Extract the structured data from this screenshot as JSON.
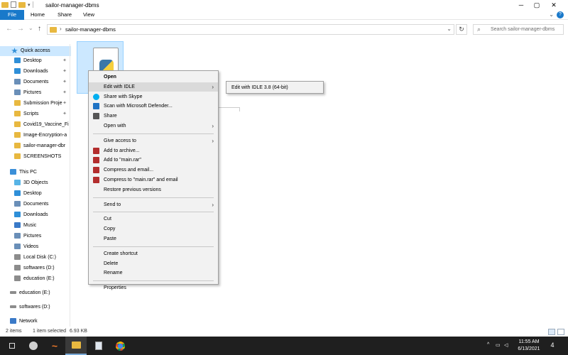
{
  "window": {
    "title": "sailor-manager-dbms",
    "controls": {
      "minimize": "─",
      "maximize": "▢",
      "close": "✕"
    }
  },
  "ribbon": {
    "tabs": [
      "File",
      "Home",
      "Share",
      "View"
    ],
    "help": "?"
  },
  "address": {
    "path": "sailor-manager-dbms",
    "separator": "›",
    "dropdown": "⌄",
    "refresh": "↻"
  },
  "search": {
    "placeholder": "Search sailor-manager-dbms",
    "icon": "⌕"
  },
  "nav": {
    "back": "←",
    "forward": "→",
    "recent": "⌄",
    "up": "↑",
    "quick_access": "Quick access",
    "pinned": [
      {
        "label": "Desktop",
        "color": "#2f8fd8",
        "pinned": true
      },
      {
        "label": "Downloads",
        "color": "#2f8fd8",
        "pinned": true
      },
      {
        "label": "Documents",
        "color": "#6a8fb8",
        "pinned": true
      },
      {
        "label": "Pictures",
        "color": "#6a8fb8",
        "pinned": true
      },
      {
        "label": "Submission Proje",
        "color": "#e8b840",
        "pinned": true
      },
      {
        "label": "Scripts",
        "color": "#e8b840",
        "pinned": true
      },
      {
        "label": "Covid19_Vaccine_Fi",
        "color": "#e8b840",
        "pinned": false
      },
      {
        "label": "Image-Encryption-a",
        "color": "#e8b840",
        "pinned": false
      },
      {
        "label": "sailor-manager-dbr",
        "color": "#e8b840",
        "pinned": false
      },
      {
        "label": "SCREENSHOTS",
        "color": "#e8b840",
        "pinned": false
      }
    ],
    "this_pc": "This PC",
    "pc_items": [
      {
        "label": "3D Objects",
        "color": "#58b4e6"
      },
      {
        "label": "Desktop",
        "color": "#2f8fd8"
      },
      {
        "label": "Documents",
        "color": "#6a8fb8"
      },
      {
        "label": "Downloads",
        "color": "#2f8fd8"
      },
      {
        "label": "Music",
        "color": "#3a7ac8"
      },
      {
        "label": "Pictures",
        "color": "#6a8fb8"
      },
      {
        "label": "Videos",
        "color": "#6a8fb8"
      },
      {
        "label": "Local Disk (C:)",
        "color": "#8c8c8c"
      },
      {
        "label": "softwares (D:)",
        "color": "#8c8c8c"
      },
      {
        "label": "education (E:)",
        "color": "#8c8c8c"
      }
    ],
    "drives": [
      {
        "label": "education (E:)",
        "color": "#8c8c8c"
      },
      {
        "label": "softwares (D:)",
        "color": "#8c8c8c"
      }
    ],
    "network": "Network"
  },
  "context_menu": {
    "items": [
      {
        "label": "Open",
        "bold": true
      },
      {
        "label": "Edit with IDLE",
        "submenu": true,
        "hover": true
      },
      {
        "label": "Share with Skype",
        "icon": "skype-icon",
        "icon_color": "#00aff0"
      },
      {
        "label": "Scan with Microsoft Defender...",
        "icon": "defender-icon",
        "icon_color": "#1f73c4"
      },
      {
        "label": "Share",
        "icon": "share-icon",
        "icon_color": "#555"
      },
      {
        "label": "Open with",
        "submenu": true
      },
      {
        "sep": true
      },
      {
        "label": "Give access to",
        "submenu": true
      },
      {
        "label": "Add to archive...",
        "icon": "winrar-icon",
        "icon_color": "#b32d2d"
      },
      {
        "label": "Add to \"main.rar\"",
        "icon": "winrar-icon",
        "icon_color": "#b32d2d"
      },
      {
        "label": "Compress and email...",
        "icon": "winrar-icon",
        "icon_color": "#b32d2d"
      },
      {
        "label": "Compress to \"main.rar\" and email",
        "icon": "winrar-icon",
        "icon_color": "#b32d2d"
      },
      {
        "label": "Restore previous versions"
      },
      {
        "sep": true
      },
      {
        "label": "Send to",
        "submenu": true
      },
      {
        "sep": true
      },
      {
        "label": "Cut"
      },
      {
        "label": "Copy"
      },
      {
        "label": "Paste"
      },
      {
        "sep": true
      },
      {
        "label": "Create shortcut"
      },
      {
        "label": "Delete"
      },
      {
        "label": "Rename"
      },
      {
        "sep": true
      },
      {
        "label": "Properties"
      }
    ],
    "submenu_item": "Edit with IDLE 3.8 (64-bit)",
    "arrow": "›"
  },
  "status": {
    "items": "2 items",
    "selected": "1 item selected",
    "size": "6.93 KB"
  },
  "taskbar": {
    "time": "11:55 AM",
    "date": "6/13/2021",
    "notifications": "4",
    "tray": "^",
    "colors": {
      "bg": "#1f1f1f",
      "accent": "#1979ca"
    }
  }
}
